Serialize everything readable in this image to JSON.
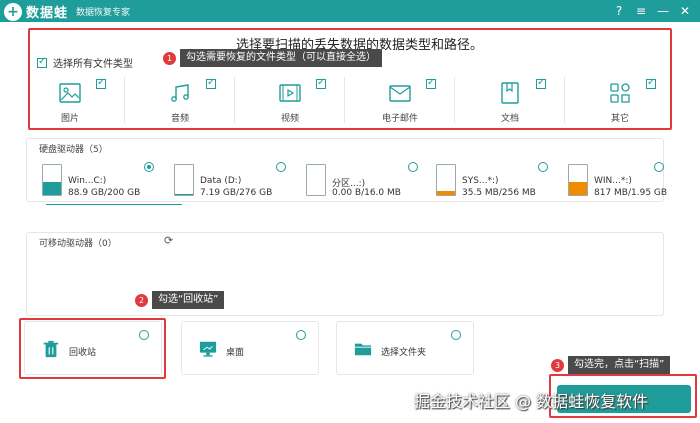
{
  "titlebar": {
    "logo_glyph": "+",
    "app_name": "数据蛙",
    "subtitle": "数据恢复专家",
    "controls": [
      "?",
      "≡",
      "—",
      "✕"
    ]
  },
  "file_types": {
    "title": "选择要扫描的丢失数据的数据类型和路径。",
    "select_all_label": "选择所有文件类型",
    "items": [
      {
        "label": "图片",
        "icon": "image-icon",
        "checked": true
      },
      {
        "label": "音频",
        "icon": "music-icon",
        "checked": true
      },
      {
        "label": "视频",
        "icon": "video-icon",
        "checked": true
      },
      {
        "label": "电子邮件",
        "icon": "email-icon",
        "checked": true
      },
      {
        "label": "文档",
        "icon": "document-icon",
        "checked": true
      },
      {
        "label": "其它",
        "icon": "other-icon",
        "checked": true
      }
    ]
  },
  "callouts": {
    "c1": {
      "num": "1",
      "text": "勾选需要恢复的文件类型（可以直接全选）"
    },
    "c2": {
      "num": "2",
      "text": "勾选“回收站”"
    },
    "c3": {
      "num": "3",
      "text": "勾选完，点击“扫描”"
    }
  },
  "hard_drives": {
    "label": "硬盘驱动器（5）",
    "drives": [
      {
        "name": "Win...C:)",
        "size": "88.9 GB/200 GB",
        "fill_fraction": 0.44,
        "fill_color": "#1f9d9a",
        "selected": true
      },
      {
        "name": "Data (D:)",
        "size": "7.19 GB/276 GB",
        "fill_fraction": 0.03,
        "fill_color": "#1f9d9a",
        "selected": false
      },
      {
        "name": "分区...:)",
        "size": "0.00  B/16.0 MB",
        "fill_fraction": 0.0,
        "fill_color": "#f5a623",
        "selected": false
      },
      {
        "name": "SYS...*:)",
        "size": "35.5 MB/256 MB",
        "fill_fraction": 0.14,
        "fill_color": "#f08c00",
        "selected": false
      },
      {
        "name": "WIN...*:)",
        "size": "817 MB/1.95 GB",
        "fill_fraction": 0.42,
        "fill_color": "#f08c00",
        "selected": false
      }
    ]
  },
  "removable": {
    "label": "可移动驱动器（0）",
    "refresh_icon": "refresh-icon"
  },
  "locations": [
    {
      "label": "回收站",
      "icon": "trash-icon"
    },
    {
      "label": "桌面",
      "icon": "desktop-icon"
    },
    {
      "label": "选择文件夹",
      "icon": "folder-icon"
    }
  ],
  "watermark": "掘金技术社区 @ 数据蛙恢复软件",
  "colors": {
    "accent": "#1f9d9a",
    "highlight": "#e0393e"
  }
}
